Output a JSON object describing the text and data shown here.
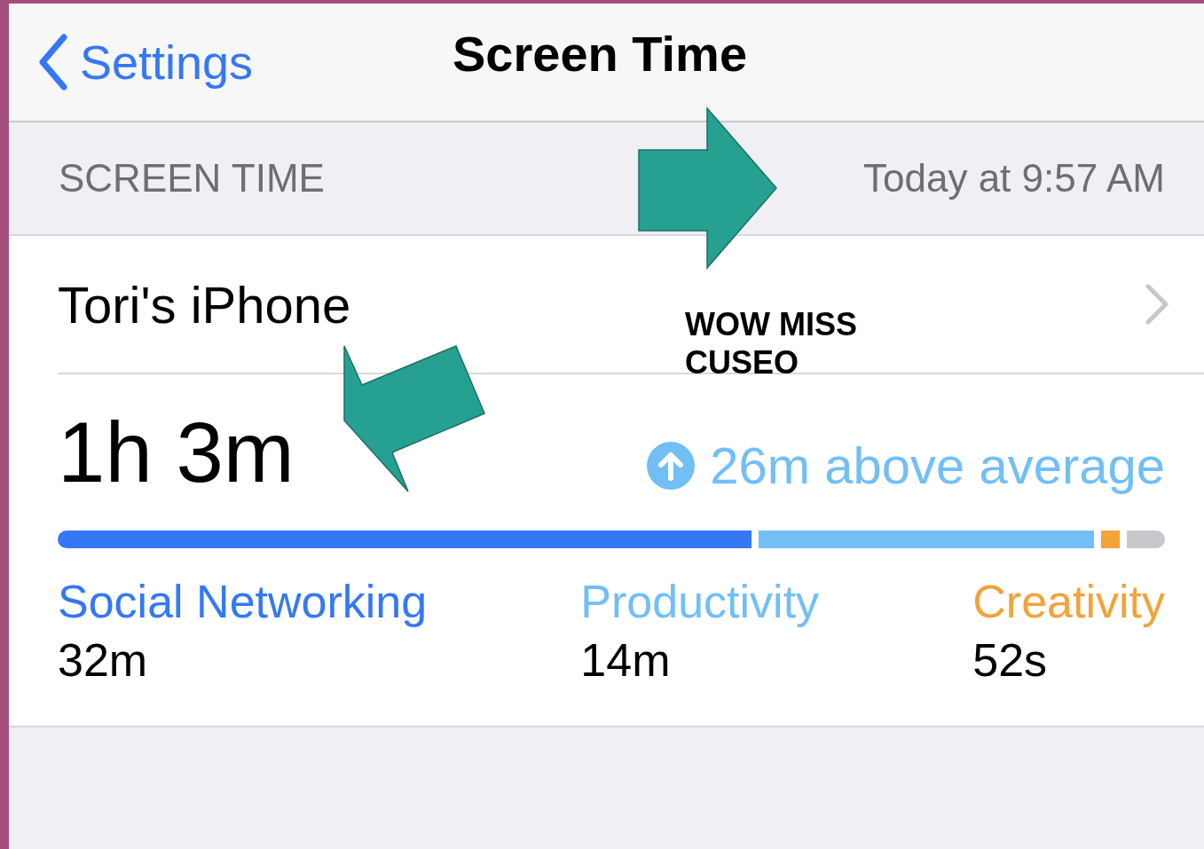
{
  "nav": {
    "back_label": "Settings",
    "title": "Screen Time"
  },
  "section": {
    "header": "SCREEN TIME",
    "timestamp": "Today at 9:57 AM"
  },
  "device": {
    "name": "Tori's iPhone"
  },
  "total": {
    "time": "1h 3m",
    "trend": "26m above average"
  },
  "categories": [
    {
      "name": "Social Networking",
      "time": "32m",
      "color": "#3478f6"
    },
    {
      "name": "Productivity",
      "time": "14m",
      "color": "#71bff5"
    },
    {
      "name": "Creativity",
      "time": "52s",
      "color": "#f2a33a"
    }
  ],
  "annotation": {
    "text": "WOW MISS CUSEO"
  }
}
